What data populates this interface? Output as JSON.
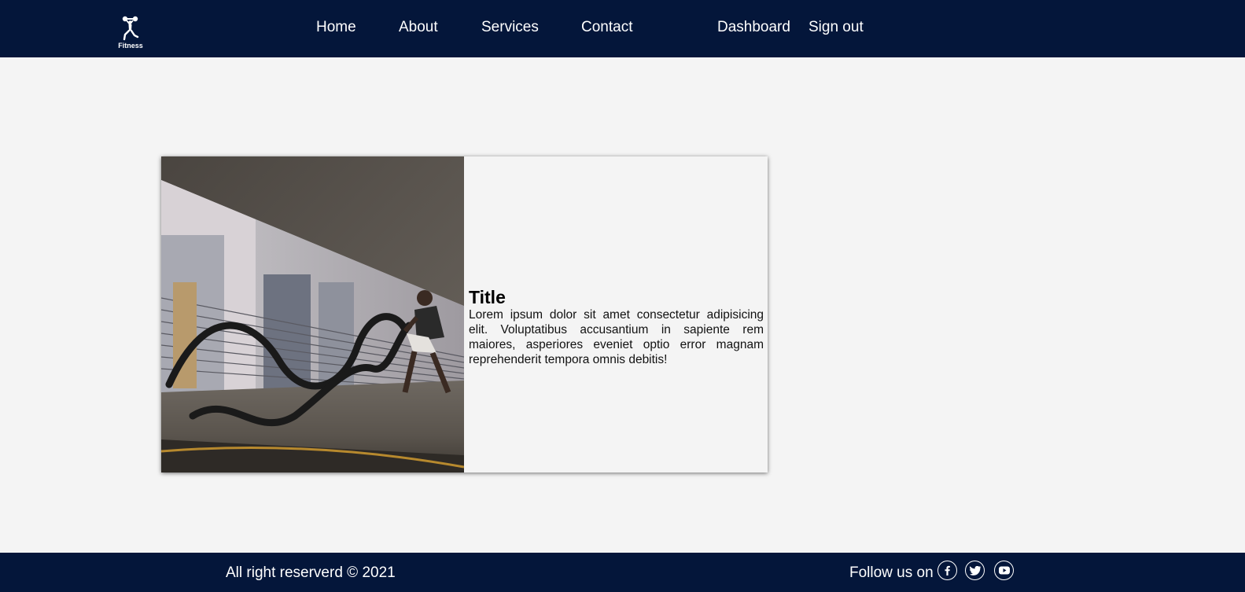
{
  "brand": {
    "logo_text": "Fitness",
    "colors": {
      "navbar": "#04163a",
      "footer": "#04163a",
      "background": "#f4f4f4"
    }
  },
  "nav": {
    "links": [
      {
        "label": "Home"
      },
      {
        "label": "About"
      },
      {
        "label": "Services"
      },
      {
        "label": "Contact"
      }
    ],
    "dashboard_label": "Dashboard",
    "signout_label": "Sign out"
  },
  "card": {
    "image_icon": "battle-ropes-photo",
    "title": "Title",
    "text": "Lorem ipsum dolor sit amet consectetur adipisicing elit. Voluptatibus accusantium in sapiente rem maiores, asperiores eveniet optio error magnam reprehenderit tempora omnis debitis!"
  },
  "footer": {
    "copyright": "All right reserverd © 2021",
    "follow_label": "Follow us on",
    "social_icons": [
      "facebook-icon",
      "twitter-icon",
      "youtube-icon"
    ]
  }
}
